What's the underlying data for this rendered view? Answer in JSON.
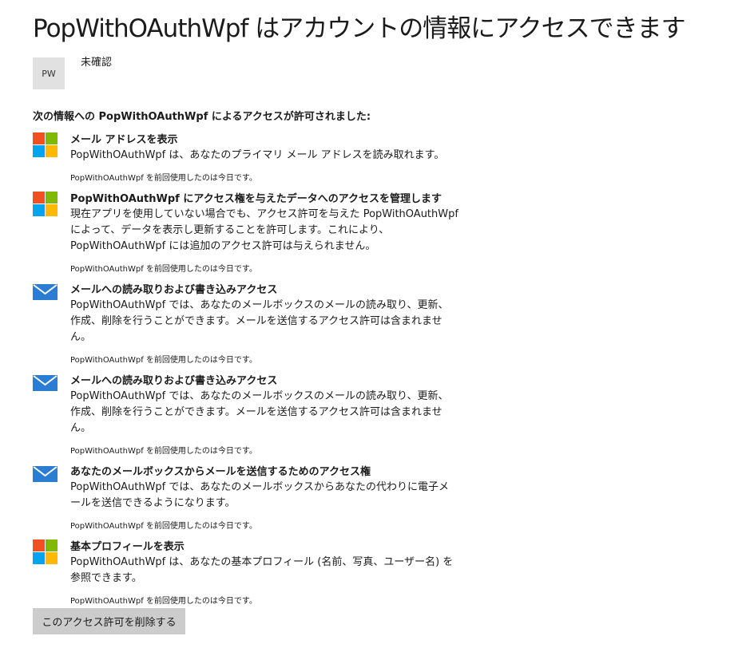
{
  "page": {
    "title": "PopWithOAuthWpf はアカウントの情報にアクセスできます",
    "app_initials": "PW",
    "app_status": "未確認",
    "intro": "次の情報への PopWithOAuthWpf によるアクセスが許可されました:",
    "remove_button": "このアクセス許可を削除する"
  },
  "colors": {
    "ms_red": "#f25022",
    "ms_green": "#7fba00",
    "ms_blue": "#00a4ef",
    "ms_yellow": "#ffb900",
    "mail_blue": "#2b7cd3",
    "button_gray": "#cccccc"
  },
  "permissions": [
    {
      "icon": "microsoft-logo-icon",
      "title": "メール アドレスを表示",
      "desc": "PopWithOAuthWpf は、あなたのプライマリ メール アドレスを読み取れます。",
      "last_used": "PopWithOAuthWpf を前回使用したのは今日です。"
    },
    {
      "icon": "microsoft-logo-icon",
      "title": "PopWithOAuthWpf にアクセス権を与えたデータへのアクセスを管理します",
      "desc": "現在アプリを使用していない場合でも、アクセス許可を与えた PopWithOAuthWpf によって、データを表示し更新することを許可します。これにより、PopWithOAuthWpf には追加のアクセス許可は与えられません。",
      "last_used": "PopWithOAuthWpf を前回使用したのは今日です。"
    },
    {
      "icon": "mail-icon",
      "title": "メールへの読み取りおよび書き込みアクセス",
      "desc": "PopWithOAuthWpf では、あなたのメールボックスのメールの読み取り、更新、作成、削除を行うことができます。メールを送信するアクセス許可は含まれません。",
      "last_used": "PopWithOAuthWpf を前回使用したのは今日です。"
    },
    {
      "icon": "mail-icon",
      "title": "メールへの読み取りおよび書き込みアクセス",
      "desc": "PopWithOAuthWpf では、あなたのメールボックスのメールの読み取り、更新、作成、削除を行うことができます。メールを送信するアクセス許可は含まれません。",
      "last_used": "PopWithOAuthWpf を前回使用したのは今日です。"
    },
    {
      "icon": "mail-icon",
      "title": "あなたのメールボックスからメールを送信するためのアクセス権",
      "desc": "PopWithOAuthWpf では、あなたのメールボックスからあなたの代わりに電子メールを送信できるようになります。",
      "last_used": "PopWithOAuthWpf を前回使用したのは今日です。"
    },
    {
      "icon": "microsoft-logo-icon",
      "title": "基本プロフィールを表示",
      "desc": "PopWithOAuthWpf は、あなたの基本プロフィール (名前、写真、ユーザー名) を参照できます。",
      "last_used": "PopWithOAuthWpf を前回使用したのは今日です。"
    }
  ]
}
